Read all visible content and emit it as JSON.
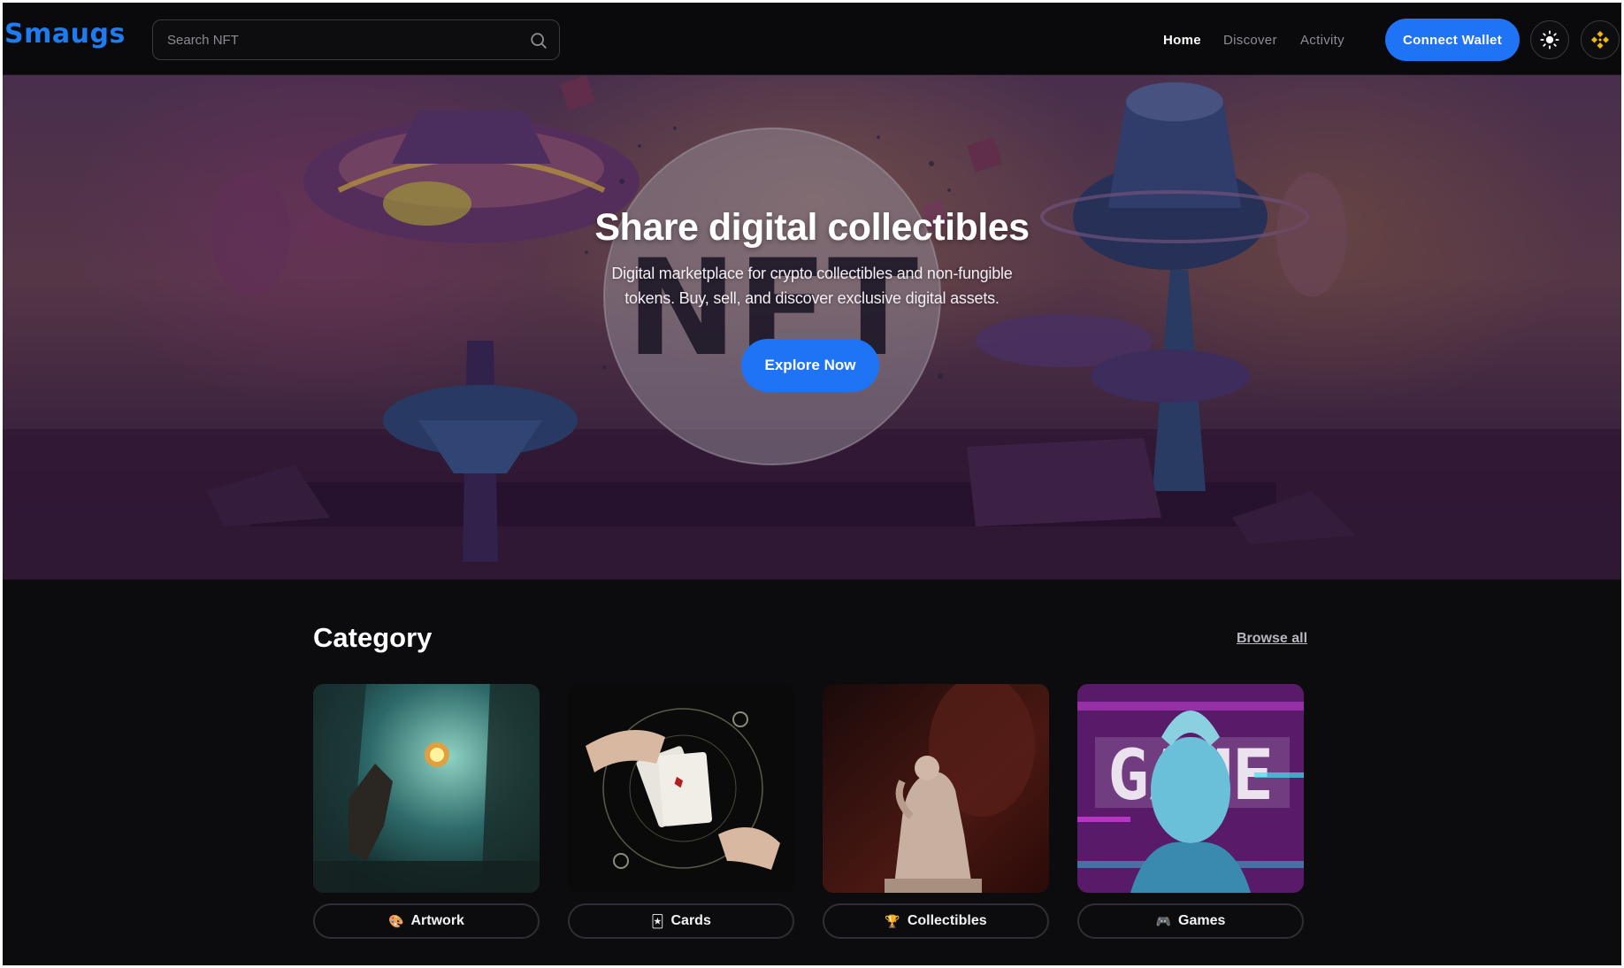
{
  "app": {
    "logo_text": "Smaugs"
  },
  "header": {
    "search_placeholder": "Search NFT",
    "nav": {
      "home": "Home",
      "discover": "Discover",
      "activity": "Activity"
    },
    "connect_label": "Connect Wallet",
    "theme_icon": "sun-icon",
    "chain_icon": "binance-icon"
  },
  "hero": {
    "title": "Share digital collectibles",
    "subtitle": "Digital marketplace for crypto collectibles and non-fungible tokens. Buy, sell, and discover exclusive digital assets.",
    "cta_label": "Explore Now"
  },
  "category": {
    "title": "Category",
    "browse_label": "Browse all",
    "items": [
      {
        "label": "Artwork",
        "icon": "🎨"
      },
      {
        "label": "Cards",
        "icon": "🃏"
      },
      {
        "label": "Collectibles",
        "icon": "🏆"
      },
      {
        "label": "Games",
        "icon": "🎮"
      }
    ]
  },
  "colors": {
    "accent": "#1f73f5",
    "background": "#0c0c0e",
    "logo": "#1e7bf0"
  }
}
